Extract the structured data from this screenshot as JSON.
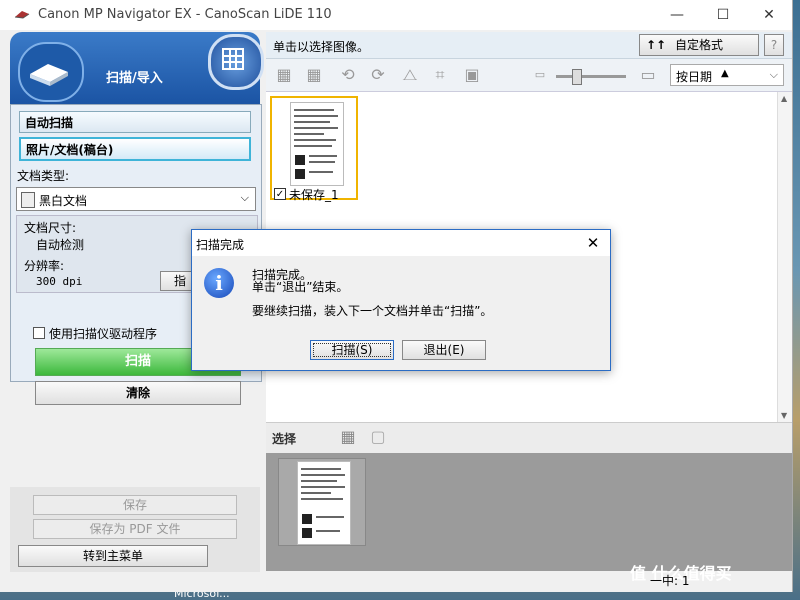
{
  "window": {
    "title": "Canon MP Navigator EX - CanoScan LiDE 110",
    "minimize": "—",
    "maximize": "☐",
    "close": "✕"
  },
  "left_panel": {
    "header_title": "扫描/导入",
    "modes": [
      "自动扫描",
      "照片/文档(稿台)"
    ],
    "document_type_label": "文档类型:",
    "document_type_value": "黑白文档",
    "document_size_label": "文档尺寸:",
    "document_size_value": "自动检测",
    "resolution_label": "分辨率:",
    "resolution_value": "300 dpi",
    "specify_button": "指",
    "use_driver_label": "使用扫描仪驱动程序",
    "scan_button": "扫描",
    "clear_button": "清除",
    "save_button": "保存",
    "save_pdf_button": "保存为 PDF 文件",
    "main_menu_button": "转到主菜单"
  },
  "right_panel": {
    "hint": "单击以选择图像。",
    "custom_format_button": "自定格式",
    "help_button": "?",
    "sort_value": "按日期",
    "sort_arrow": "▲",
    "thumbnail_label": "未保存_1",
    "thumbnail_checked": "✓",
    "select_label": "选择",
    "status_count": "一中: 1"
  },
  "dialog": {
    "title": "扫描完成",
    "close": "✕",
    "icon": "i",
    "line1": "扫描完成。",
    "line2": "单击“退出”结束。",
    "line3": "要继续扫描，装入下一个文档并单击“扫描”。",
    "scan_button": "扫描(S)",
    "exit_button": "退出(E)"
  },
  "desktop": {
    "taskbar_text": "Microsof...",
    "watermark": "值 什么值得买"
  },
  "icons": {
    "chevron": "⌵"
  }
}
